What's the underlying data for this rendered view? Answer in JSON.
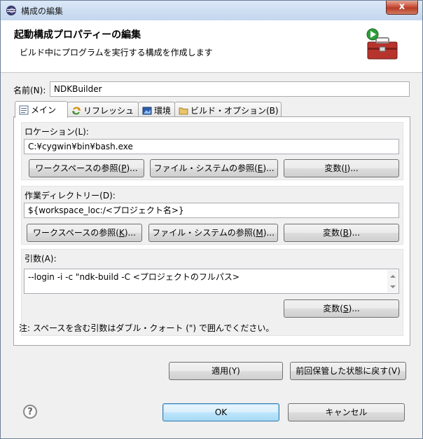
{
  "window": {
    "title": "構成の編集",
    "close_glyph": "x"
  },
  "header": {
    "title": "起動構成プロパティーの編集",
    "description": "ビルド中にプログラムを実行する構成を作成します",
    "icon": "toolbox-run-icon"
  },
  "name_field": {
    "label": "名前(N):",
    "value": "NDKBuilder"
  },
  "tabs": [
    {
      "label": "メイン",
      "icon": "main-tab-icon",
      "selected": true
    },
    {
      "label": "リフレッシュ",
      "icon": "refresh-icon",
      "selected": false
    },
    {
      "label": "環境",
      "icon": "environment-icon",
      "selected": false
    },
    {
      "label": "ビルド・オプション(B)",
      "icon": "folder-icon",
      "selected": false
    }
  ],
  "location": {
    "label": "ロケーション(L):",
    "value": "C:¥cygwin¥bin¥bash.exe",
    "workspace_btn": {
      "pre": "ワークスペースの参照(",
      "key": "P",
      "post": ")..."
    },
    "filesystem_btn": {
      "pre": "ファイル・システムの参照(",
      "key": "E",
      "post": ")..."
    },
    "variables_btn": {
      "pre": "変数(",
      "key": "I",
      "post": ")..."
    }
  },
  "working_dir": {
    "label": "作業ディレクトリー(D):",
    "value": "${workspace_loc:/<プロジェクト名>}",
    "workspace_btn": {
      "pre": "ワークスペースの参照(",
      "key": "K",
      "post": ")..."
    },
    "filesystem_btn": {
      "pre": "ファイル・システムの参照(",
      "key": "M",
      "post": ")..."
    },
    "variables_btn": {
      "pre": "変数(",
      "key": "B",
      "post": ")..."
    }
  },
  "arguments": {
    "label": "引数(A):",
    "value": "--login -i -c \"ndk-build -C <プロジェクトのフルパス>",
    "variables_btn": {
      "pre": "変数(",
      "key": "S",
      "post": ")..."
    },
    "note": "注: スペースを含む引数はダブル・クォート (\") で囲んでください。"
  },
  "panel_buttons": {
    "apply": "適用(Y)",
    "revert": "前回保管した状態に戻す(V)"
  },
  "footer": {
    "ok": "OK",
    "cancel": "キャンセル",
    "help_glyph": "?"
  },
  "colors": {
    "accent_border": "#3c7fb1",
    "close_red": "#c7503a",
    "panel_bg": "#f0f0f0"
  }
}
